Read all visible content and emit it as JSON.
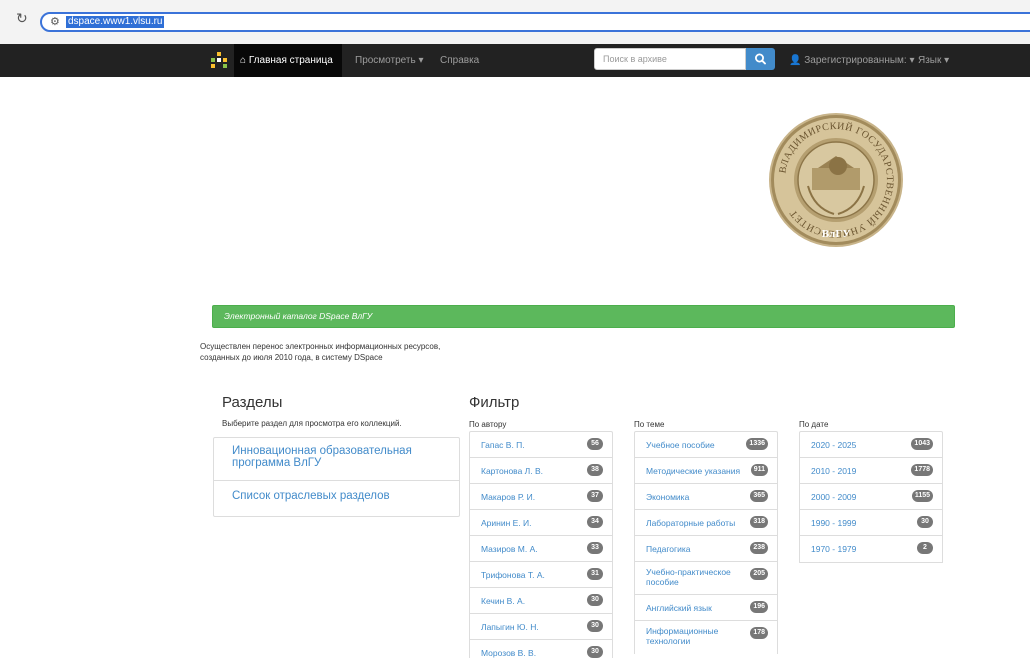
{
  "browser": {
    "url": "dspace.www1.vlsu.ru"
  },
  "navbar": {
    "home_label": "Главная страница",
    "browse_label": "Просмотреть ▾",
    "help_label": "Справка",
    "search_placeholder": "Поиск в архиве",
    "user_label": "Зарегистрированным: ▾",
    "language_label": "Язык ▾"
  },
  "seal": {
    "ring_text": "ВЛАДИМИРСКИЙ ГОСУДАРСТВЕННЫЙ УНИВЕРСИТЕТ",
    "abbr": "ВлГУ"
  },
  "banner": {
    "text": "Электронный каталог DSpace ВлГУ"
  },
  "notice": {
    "text": "Осуществлен перенос электронных информационных ресурсов, созданных до июля 2010 года, в систему DSpace"
  },
  "sections": {
    "title": "Разделы",
    "subtitle": "Выберите раздел для просмотра его коллекций.",
    "items": [
      {
        "label": "Инновационная образовательная программа ВлГУ"
      },
      {
        "label": "Список отраслевых разделов"
      }
    ]
  },
  "filter": {
    "title": "Фильтр",
    "author": {
      "label": "По автору",
      "items": [
        {
          "label": "Гапас В. П.",
          "count": "56"
        },
        {
          "label": "Картонова Л. В.",
          "count": "38"
        },
        {
          "label": "Макаров Р. И.",
          "count": "37"
        },
        {
          "label": "Аринин Е. И.",
          "count": "34"
        },
        {
          "label": "Мазиров М. А.",
          "count": "33"
        },
        {
          "label": "Трифонова Т. А.",
          "count": "31"
        },
        {
          "label": "Кечин В. А.",
          "count": "30"
        },
        {
          "label": "Лапыгин Ю. Н.",
          "count": "30"
        },
        {
          "label": "Морозов В. В.",
          "count": "30"
        }
      ]
    },
    "subject": {
      "label": "По теме",
      "items": [
        {
          "label": "Учебное пособие",
          "count": "1336"
        },
        {
          "label": "Методические указания",
          "count": "911"
        },
        {
          "label": "Экономика",
          "count": "365"
        },
        {
          "label": "Лабораторные работы",
          "count": "318"
        },
        {
          "label": "Педагогика",
          "count": "238"
        },
        {
          "label": "Учебно-практическое пособие",
          "count": "205"
        },
        {
          "label": "Английский язык",
          "count": "196"
        },
        {
          "label": "Информационные технологии",
          "count": "178"
        }
      ]
    },
    "date": {
      "label": "По дате",
      "items": [
        {
          "label": "2020 - 2025",
          "count": "1043"
        },
        {
          "label": "2010 - 2019",
          "count": "1778"
        },
        {
          "label": "2000 - 2009",
          "count": "1155"
        },
        {
          "label": "1990 - 1999",
          "count": "30"
        },
        {
          "label": "1970 - 1979",
          "count": "2"
        }
      ]
    }
  },
  "colors": {
    "navbar_bg": "#222222",
    "link": "#428bca",
    "banner": "#5cb85c",
    "badge": "#777777",
    "url_highlight": "#2f6fd6"
  }
}
